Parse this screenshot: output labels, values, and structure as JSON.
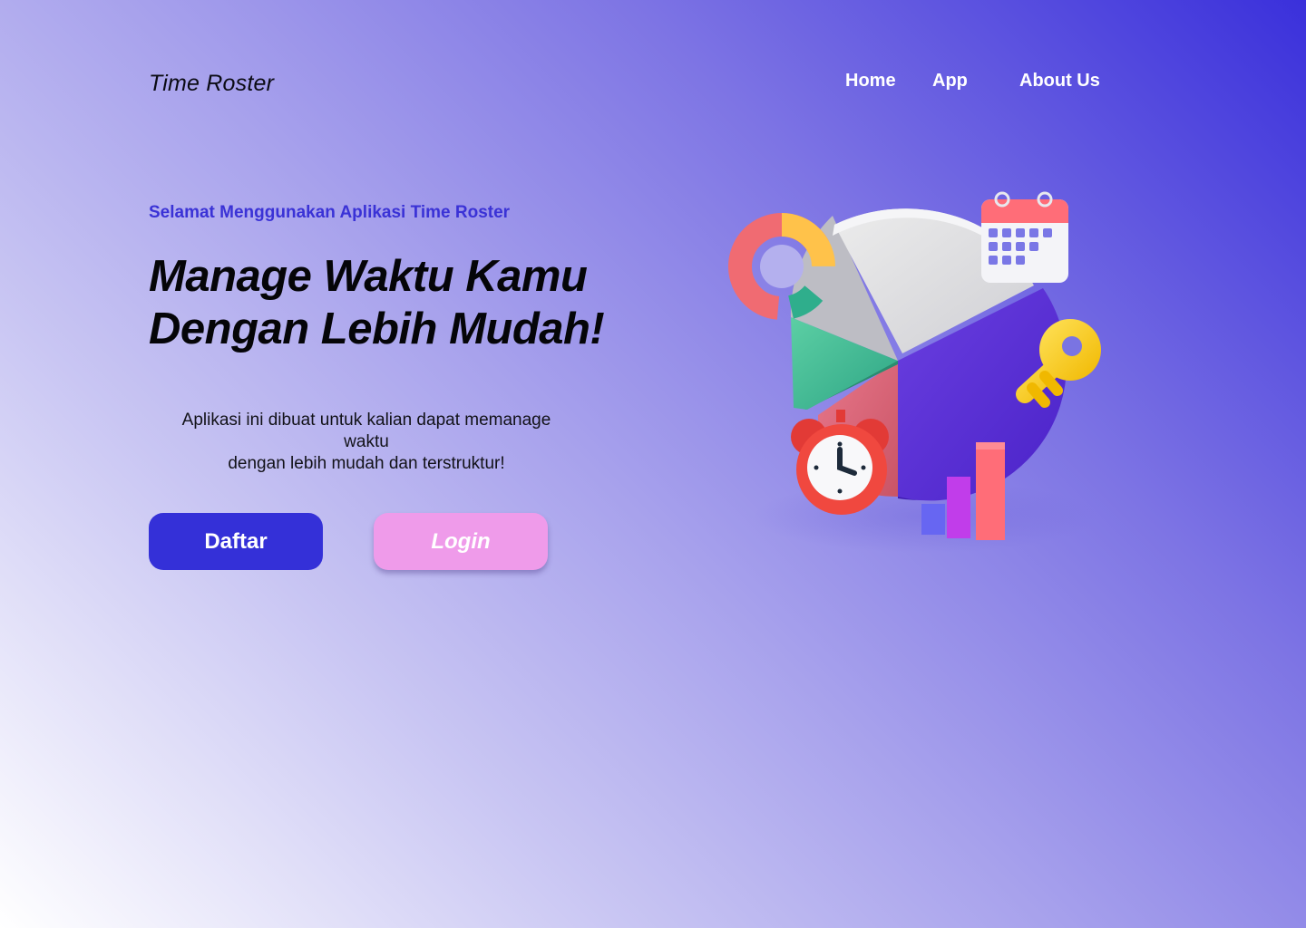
{
  "header": {
    "logo": "Time Roster",
    "nav": {
      "home": "Home",
      "app": "App",
      "about": "About Us"
    }
  },
  "hero": {
    "tagline": "Selamat Menggunakan Aplikasi Time Roster",
    "headline_line1": "Manage Waktu Kamu",
    "headline_line2": "Dengan Lebih Mudah!",
    "description_line1": "Aplikasi ini dibuat untuk kalian dapat memanage",
    "description_line2": "waktu",
    "description_line3": "dengan lebih mudah dan terstruktur!",
    "button_primary": "Daftar",
    "button_secondary": "Login"
  },
  "illustration": {
    "icons": [
      "pie-chart-icon",
      "donut-chart-icon",
      "calendar-icon",
      "key-icon",
      "alarm-clock-icon",
      "bar-chart-icon"
    ]
  },
  "colors": {
    "accent": "#3430d8",
    "login_button": "#ef9bea",
    "tagline": "#3a32d6"
  }
}
